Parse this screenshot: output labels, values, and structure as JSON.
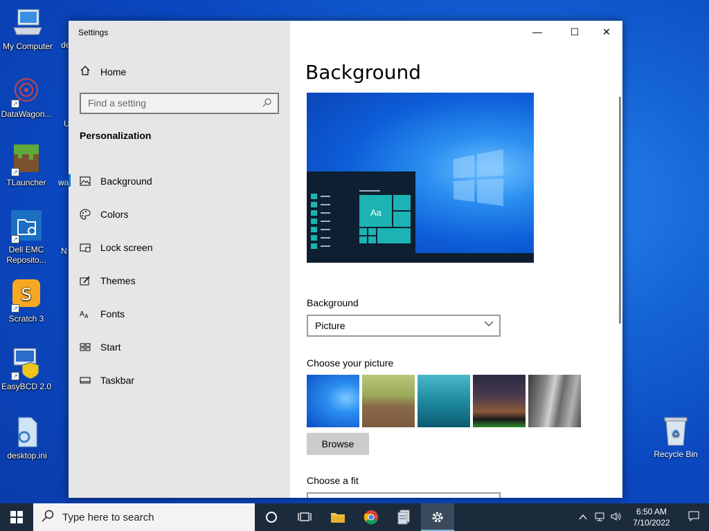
{
  "desktop": {
    "icons": [
      {
        "label": "My Computer"
      },
      {
        "label": "DataWagon..."
      },
      {
        "label": "TLauncher"
      },
      {
        "label": "Dell EMC Reposito..."
      },
      {
        "label": "Scratch 3"
      },
      {
        "label": "EasyBCD 2.0"
      },
      {
        "label": "desktop.ini"
      }
    ],
    "partial_labels": [
      "de",
      "U",
      "wa",
      "N"
    ],
    "recycle_bin": "Recycle Bin"
  },
  "window": {
    "title": "Settings",
    "controls": {
      "minimize": "—",
      "maximize": "☐",
      "close": "✕"
    }
  },
  "sidebar": {
    "home": "Home",
    "search_placeholder": "Find a setting",
    "section": "Personalization",
    "items": [
      {
        "label": "Background",
        "icon": "picture-icon"
      },
      {
        "label": "Colors",
        "icon": "palette-icon"
      },
      {
        "label": "Lock screen",
        "icon": "lock-screen-icon"
      },
      {
        "label": "Themes",
        "icon": "themes-icon"
      },
      {
        "label": "Fonts",
        "icon": "fonts-icon"
      },
      {
        "label": "Start",
        "icon": "start-icon"
      },
      {
        "label": "Taskbar",
        "icon": "taskbar-icon"
      }
    ]
  },
  "main": {
    "title": "Background",
    "preview_sample_text": "Aa",
    "background_label": "Background",
    "background_value": "Picture",
    "choose_picture_label": "Choose your picture",
    "browse_label": "Browse",
    "choose_fit_label": "Choose a fit"
  },
  "taskbar": {
    "search_placeholder": "Type here to search",
    "time": "6:50 AM",
    "date": "7/10/2022"
  },
  "colors": {
    "accent": "#0078d7",
    "tile_teal": "#1bb3b3",
    "taskbar": "#1c2b3c"
  }
}
